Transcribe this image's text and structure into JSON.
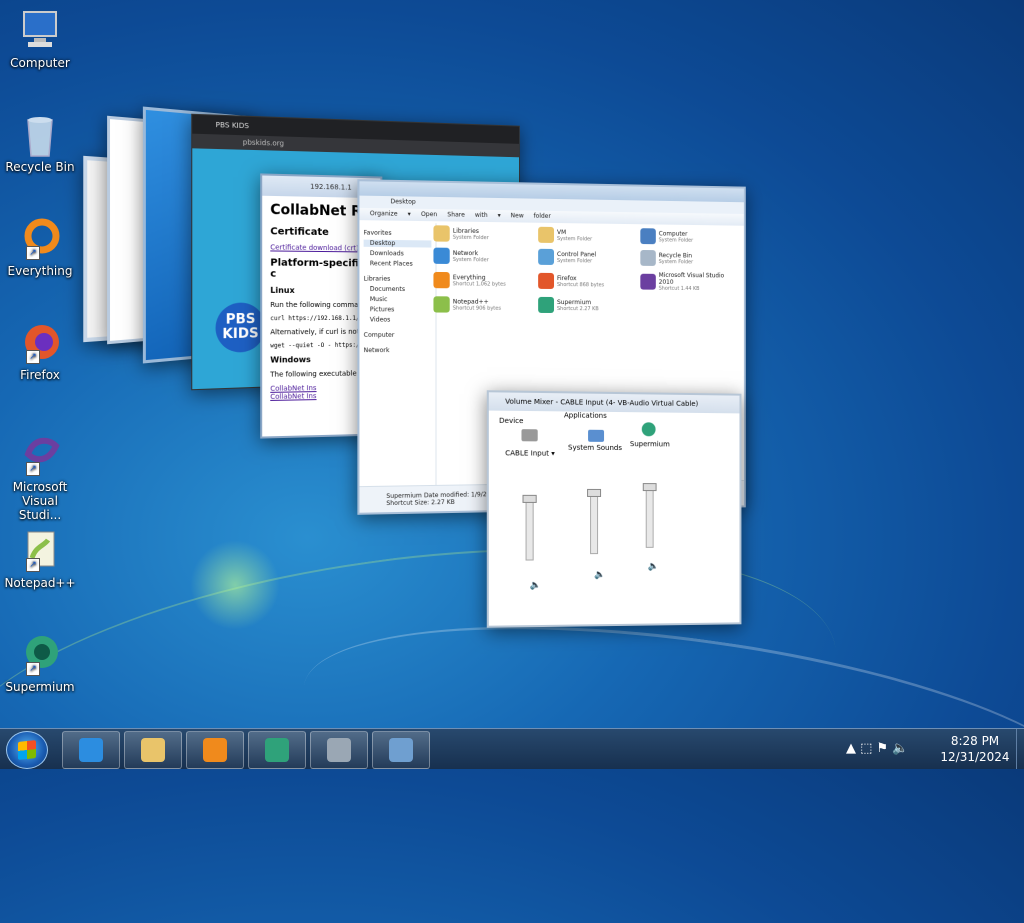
{
  "desktop": {
    "icons": [
      {
        "label": "Computer",
        "glyph": "computer-icon"
      },
      {
        "label": "Recycle Bin",
        "glyph": "recycle-bin-icon"
      },
      {
        "label": "Everything",
        "glyph": "everything-icon"
      },
      {
        "label": "Firefox",
        "glyph": "firefox-icon"
      },
      {
        "label": "Microsoft Visual Studi...",
        "glyph": "visual-studio-icon"
      },
      {
        "label": "Notepad++",
        "glyph": "notepad-plus-plus-icon"
      },
      {
        "label": "Supermium",
        "glyph": "supermium-icon"
      }
    ]
  },
  "windows": {
    "pbs": {
      "tab": "PBS KIDS",
      "address": "pbskids.org",
      "logo_line1": "PBS",
      "logo_line2": "KIDS"
    },
    "collabnet": {
      "address": "192.168.1.1",
      "title": "CollabNet Ro",
      "h_cert": "Certificate",
      "link_cert": "Certificate download (crt)",
      "h_platform": "Platform-specific c",
      "h_linux": "Linux",
      "linux_text": "Run the following command t",
      "linux_cmd": "curl https://192.168.1.1/",
      "alt_text": "Alternatively, if curl is not ins",
      "wget_cmd": "wget --quiet -O - https://",
      "h_windows": "Windows",
      "win_text": "The following executable wil",
      "link1": "CollabNet Ins",
      "link2": "CollabNet Ins"
    },
    "explorer": {
      "address": "Desktop",
      "toolbar": "Organize ▾   Open   Share with ▾   New folder",
      "sidebar": [
        "Favorites",
        "Desktop",
        "Downloads",
        "Recent Places",
        "Libraries",
        "Documents",
        "Music",
        "Pictures",
        "Videos",
        "Computer",
        "Network"
      ],
      "items": [
        {
          "name": "Libraries",
          "sub": "System Folder",
          "color": "#e9c46a"
        },
        {
          "name": "VM",
          "sub": "System Folder",
          "color": "#e9c46a"
        },
        {
          "name": "Computer",
          "sub": "System Folder",
          "color": "#4a7fc1"
        },
        {
          "name": "Network",
          "sub": "System Folder",
          "color": "#3a8ad6"
        },
        {
          "name": "Control Panel",
          "sub": "System Folder",
          "color": "#5aa0d8"
        },
        {
          "name": "Recycle Bin",
          "sub": "System Folder",
          "color": "#a7b7c8"
        },
        {
          "name": "Everything",
          "sub": "Shortcut\n1,062 bytes",
          "color": "#f08a1c"
        },
        {
          "name": "Firefox",
          "sub": "Shortcut\n868 bytes",
          "color": "#e2562a"
        },
        {
          "name": "Microsoft Visual Studio 2010",
          "sub": "Shortcut\n1.44 KB",
          "color": "#6b3fa0"
        },
        {
          "name": "Notepad++",
          "sub": "Shortcut\n906 bytes",
          "color": "#8cbf4a"
        },
        {
          "name": "Supermium",
          "sub": "Shortcut\n2.27 KB",
          "color": "#2fa27a"
        }
      ],
      "status_name": "Supermium",
      "status_info": "Date modified: 1/9/2024",
      "status_type": "Shortcut",
      "status_size": "Size: 2.27 KB"
    },
    "mixer": {
      "title": "Volume Mixer - CABLE Input (4- VB-Audio Virtual Cable)",
      "device_label": "Device",
      "applications_label": "Applications",
      "device_name": "CABLE Input ▾",
      "app1": "System Sounds",
      "app2": "Supermium"
    }
  },
  "taskbar": {
    "start_label": "Start",
    "buttons": [
      {
        "name": "internet-explorer-button",
        "color": "#2c8de0"
      },
      {
        "name": "windows-explorer-button",
        "color": "#e9c46a"
      },
      {
        "name": "media-player-button",
        "color": "#f08a1c"
      },
      {
        "name": "supermium-button",
        "color": "#2fa27a"
      },
      {
        "name": "dvd-button",
        "color": "#9aa7b4"
      },
      {
        "name": "remote-desktop-button",
        "color": "#6f9fd0"
      }
    ],
    "tray_glyphs": "▲  ⬚  ⚑  🔈",
    "time": "8:28 PM",
    "date": "12/31/2024"
  }
}
